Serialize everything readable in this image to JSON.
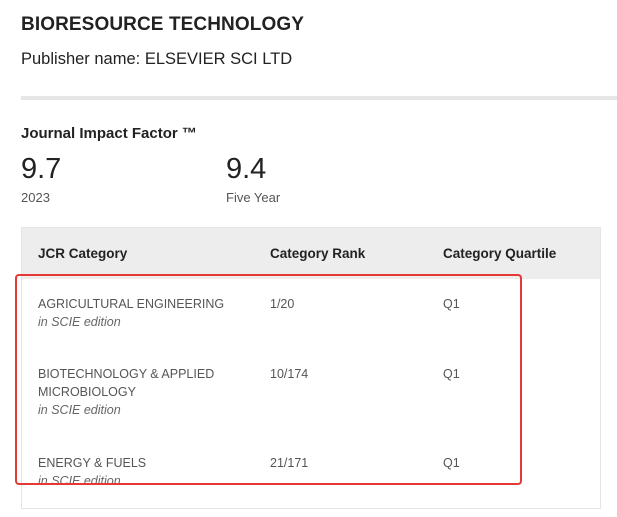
{
  "journal": {
    "title": "BIORESOURCE TECHNOLOGY",
    "publisher": "Publisher name: ELSEVIER SCI LTD"
  },
  "impact_factor": {
    "heading": "Journal Impact Factor ™",
    "current_value": "9.7",
    "current_label": "2023",
    "five_year_value": "9.4",
    "five_year_label": "Five Year"
  },
  "table": {
    "headers": [
      "JCR Category",
      "Category Rank",
      "Category Quartile"
    ],
    "rows": [
      {
        "category": "AGRICULTURAL ENGINEERING",
        "edition": "in SCIE edition",
        "rank": "1/20",
        "quartile": "Q1"
      },
      {
        "category": "BIOTECHNOLOGY & APPLIED MICROBIOLOGY",
        "edition": "in SCIE edition",
        "rank": "10/174",
        "quartile": "Q1"
      },
      {
        "category": "ENERGY & FUELS",
        "edition": "in SCIE edition",
        "rank": "21/171",
        "quartile": "Q1"
      }
    ]
  },
  "colors": {
    "highlight": "#e53935",
    "header_bg": "#ededed"
  }
}
